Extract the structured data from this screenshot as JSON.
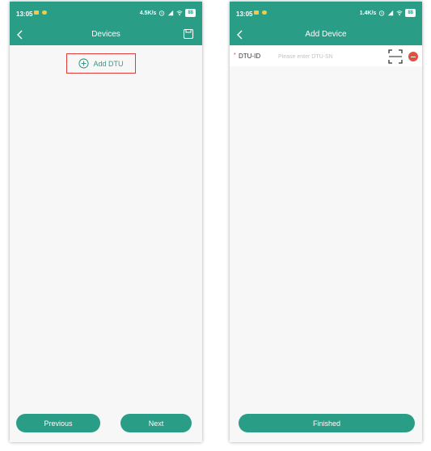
{
  "left_screen": {
    "status_bar": {
      "time": "13:05",
      "speed": "4.5K/s",
      "battery": "88"
    },
    "nav": {
      "title": "Devices"
    },
    "add_dtu_label": "Add DTU",
    "previous_label": "Previous",
    "next_label": "Next"
  },
  "right_screen": {
    "status_bar": {
      "time": "13:05",
      "speed": "1.4K/s",
      "battery": "88"
    },
    "nav": {
      "title": "Add Device"
    },
    "dtu_field": {
      "required_mark": "*",
      "label": "DTU-ID",
      "value": "",
      "placeholder": "Please enter DTU-SN"
    },
    "finished_label": "Finished"
  },
  "colors": {
    "accent": "#2a9d86",
    "highlight_box": "#e03a3a",
    "remove_button": "#e05040",
    "background": "#f7f7f8"
  },
  "icons": {
    "back": "chevron-left-icon",
    "save": "save-icon",
    "add": "plus-circle-icon",
    "scan": "scan-frame-icon",
    "remove": "minus-circle-icon"
  }
}
